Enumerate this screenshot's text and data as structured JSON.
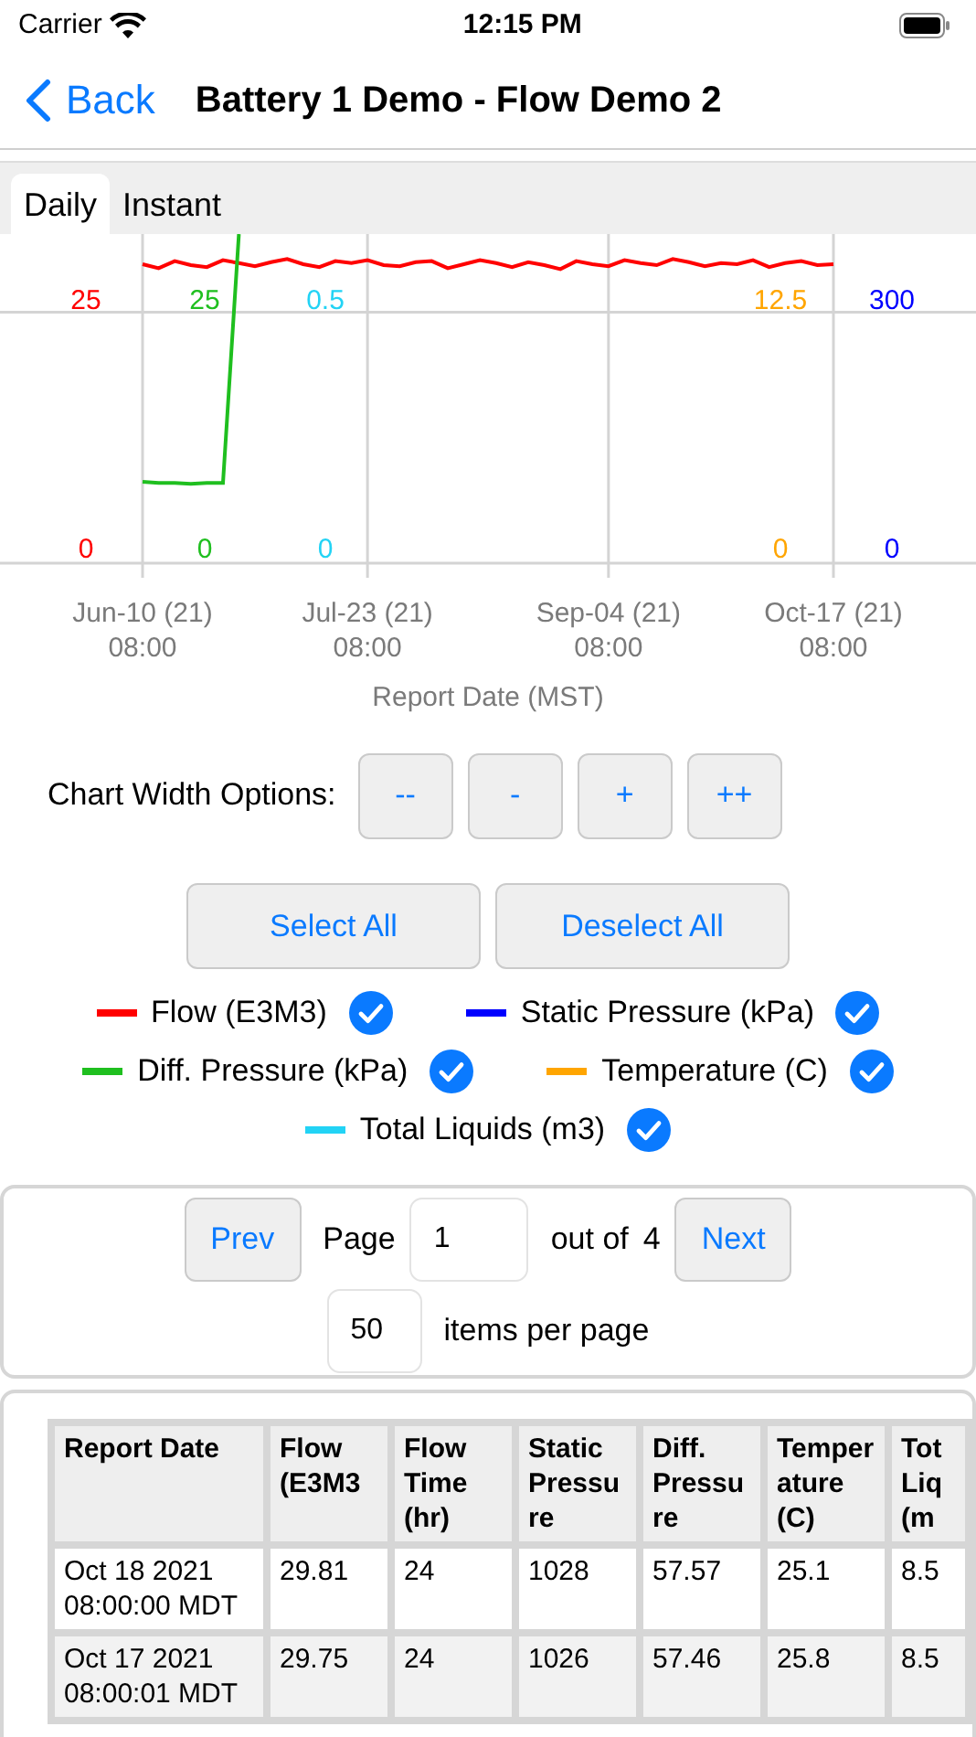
{
  "status_bar": {
    "carrier": "Carrier",
    "time": "12:15 PM"
  },
  "nav_bar": {
    "back": "Back",
    "title": "Battery 1 Demo - Flow Demo 2"
  },
  "tabs": [
    {
      "label": "Daily",
      "selected": true
    },
    {
      "label": "Instant",
      "selected": false
    }
  ],
  "chart": {
    "axes": [
      {
        "color": "#ff0000",
        "high": "25",
        "low": "0"
      },
      {
        "color": "#1fbf1f",
        "high": "25",
        "low": "0"
      },
      {
        "color": "#22d3f5",
        "high": "0.5",
        "low": "0"
      },
      {
        "color": "#ffa500",
        "high": "12.5",
        "low": "0"
      },
      {
        "color": "#0000ff",
        "high": "300",
        "low": "0"
      }
    ],
    "chart_data": {
      "type": "line",
      "xlabel": "Report Date (MST)",
      "categories": [
        "Jun-10 (21) 08:00",
        null,
        null,
        null,
        null,
        null,
        null,
        null,
        null,
        null,
        null,
        null,
        null,
        null,
        "Jul-23 (21) 08:00",
        null,
        null,
        null,
        null,
        null,
        null,
        null,
        null,
        null,
        null,
        null,
        null,
        null,
        null,
        "Sep-04 (21) 08:00",
        null,
        null,
        null,
        null,
        null,
        null,
        null,
        null,
        null,
        null,
        null,
        null,
        null,
        "Oct-17 (21) 08:00"
      ],
      "yticks": [
        0,
        25
      ],
      "ylim": [
        0,
        32.8
      ],
      "grid": true,
      "series": [
        {
          "color": "#ff0000",
          "values": [
            29.8,
            29.4,
            30.1,
            29.7,
            29.5,
            30.2,
            29.9,
            29.6,
            30.0,
            30.3,
            29.8,
            29.5,
            30.1,
            29.9,
            30.2,
            29.7,
            29.6,
            30.0,
            30.1,
            29.4,
            29.8,
            30.2,
            29.9,
            29.5,
            30.0,
            29.7,
            29.3,
            30.1,
            29.8,
            29.6,
            30.2,
            29.9,
            29.7,
            30.3,
            30.0,
            29.6,
            29.9,
            29.8,
            30.2,
            29.5,
            29.9,
            30.1,
            29.7,
            29.8
          ]
        },
        {
          "color": "#1fbf1f",
          "values": [
            8.1,
            8.0,
            8.0,
            7.9,
            8.0,
            8.0,
            32.8,
            null,
            null,
            null,
            null,
            null,
            null,
            null,
            null,
            null,
            null,
            null,
            null,
            null,
            null,
            null,
            null,
            null,
            null,
            null,
            null,
            null,
            null,
            null,
            null,
            null,
            null,
            null,
            null,
            null,
            null,
            null,
            null,
            null,
            null,
            null,
            null,
            null
          ]
        }
      ]
    }
  },
  "width_options": {
    "label": "Chart Width Options:",
    "buttons": [
      "--",
      "-",
      "+",
      "++"
    ]
  },
  "selection_buttons": [
    "Select All",
    "Deselect All"
  ],
  "legend": [
    {
      "label": "Flow (E3M3)",
      "color": "#ff0000",
      "checked": true
    },
    {
      "label": "Static Pressure (kPa)",
      "color": "#0000ff",
      "checked": true
    },
    {
      "label": "Diff. Pressure (kPa)",
      "color": "#1fbf1f",
      "checked": true
    },
    {
      "label": "Temperature (C)",
      "color": "#ffa500",
      "checked": true
    },
    {
      "label": "Total Liquids (m3)",
      "color": "#22d3f5",
      "checked": true
    }
  ],
  "pagination": {
    "prev": "Prev",
    "page_label": "Page",
    "page": "1",
    "out_of": "out of",
    "total": "4",
    "next": "Next",
    "per_page": "50",
    "per_page_label": "items per page"
  },
  "table": {
    "columns": [
      "Report Date",
      "Flow (E3M3",
      "Flow Time (hr)",
      "Static Pressure",
      "Diff. Pressure",
      "Temperature (C)",
      "Tot Liq (m"
    ],
    "rows": [
      [
        "Oct 18 2021 08:00:00 MDT",
        "29.81",
        "24",
        "1028",
        "57.57",
        "25.1",
        "8.5"
      ],
      [
        "Oct 17 2021 08:00:01 MDT",
        "29.75",
        "24",
        "1026",
        "57.46",
        "25.8",
        "8.5"
      ]
    ]
  }
}
